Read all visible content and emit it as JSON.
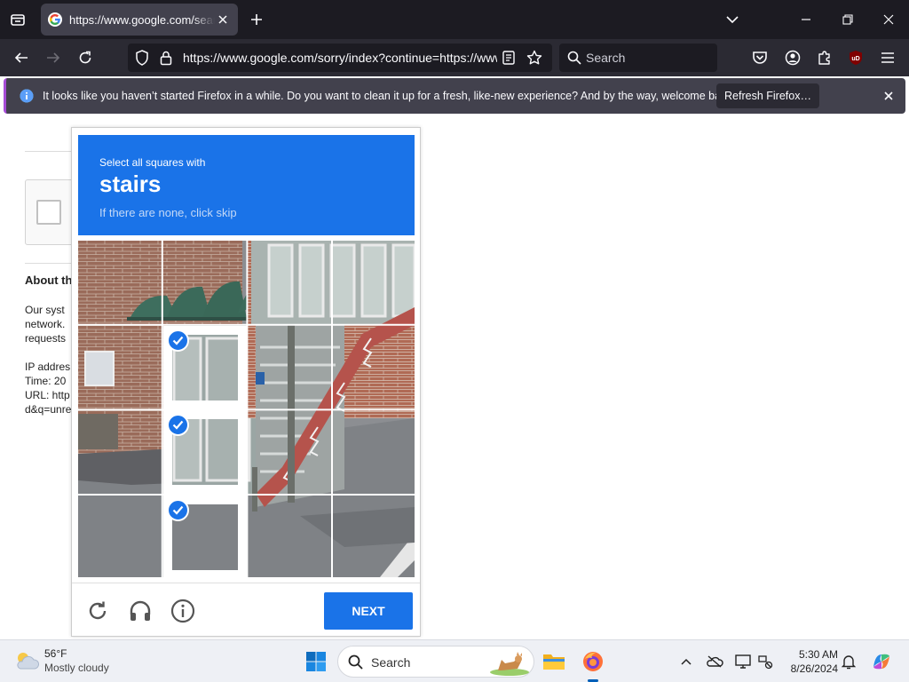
{
  "browser": {
    "tab_title": "https://www.google.com/search",
    "url": "https://www.google.com/sorry/index?continue=https://www.google.com/search",
    "search_placeholder": "Search",
    "notification_text": "It looks like you haven’t started Firefox in a while. Do you want to clean it up for a fresh, like-new experience? And by the way, welcome back!",
    "refresh_label": "Refresh Firefox…",
    "extension_badge": "uD"
  },
  "page": {
    "about_heading": "About th",
    "body_lines": [
      "Our syst",
      "network.",
      "requests"
    ],
    "info_lines": [
      "IP addres",
      "Time: 20",
      "URL: http",
      "d&q=unre"
    ]
  },
  "captcha": {
    "instruction": "Select all squares with",
    "target": "stairs",
    "hint": "If there are none, click skip",
    "next_label": "NEXT",
    "selected_tiles": [
      {
        "row": 1,
        "col": 1
      },
      {
        "row": 2,
        "col": 1
      },
      {
        "row": 3,
        "col": 1
      }
    ],
    "footer_icons": [
      "reload-icon",
      "audio-icon",
      "info-icon"
    ]
  },
  "taskbar": {
    "temperature": "56°F",
    "condition": "Mostly cloudy",
    "search_placeholder": "Search",
    "time": "5:30 AM",
    "date": "8/26/2024"
  },
  "colors": {
    "accent": "#1a73e8",
    "chrome_dark": "#1c1b22",
    "notification_border": "#a64cd6"
  }
}
